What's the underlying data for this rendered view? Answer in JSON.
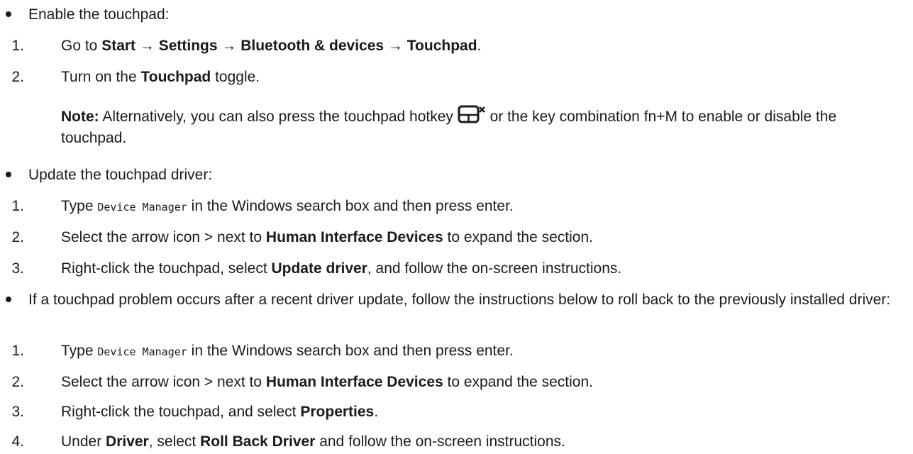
{
  "section1": {
    "bullet": "Enable the touchpad:",
    "step1": {
      "num": "1.",
      "pre": "Go to ",
      "bold": "Start → Settings → Bluetooth & devices → Touchpad",
      "post": "."
    },
    "step2": {
      "num": "2.",
      "pre": "Turn on the ",
      "bold": "Touchpad",
      "post": " toggle."
    },
    "note": {
      "label": "Note:",
      "pre": " Alternatively, you can also press the touchpad hotkey ",
      "post": " or the key combination fn+M to enable or disable the touchpad.",
      "icon": "touchpad-disable-hotkey-icon"
    }
  },
  "section2": {
    "bullet": "Update the touchpad driver:",
    "step1": {
      "num": "1.",
      "pre": "Type ",
      "mono": "Device Manager",
      "post": " in the Windows search box and then press enter."
    },
    "step2": {
      "num": "2.",
      "pre": "Select the arrow icon > next to ",
      "bold": "Human Interface Devices",
      "post": " to expand the section."
    },
    "step3": {
      "num": "3.",
      "pre": "Right-click the touchpad, select ",
      "bold": "Update driver",
      "post": ", and follow the on-screen instructions."
    }
  },
  "section3": {
    "bullet": "If a touchpad problem occurs after a recent driver update, follow the instructions below to roll back to the previously installed driver:",
    "step1": {
      "num": "1.",
      "pre": "Type ",
      "mono": "Device Manager",
      "post": " in the Windows search box and then press enter."
    },
    "step2": {
      "num": "2.",
      "pre": "Select the arrow icon > next to ",
      "bold": "Human Interface Devices",
      "post": " to expand the section."
    },
    "step3": {
      "num": "3.",
      "pre": "Right-click the touchpad, and select ",
      "bold": "Properties",
      "post": "."
    },
    "step4": {
      "num": "4.",
      "pre": "Under ",
      "bold1": "Driver",
      "mid": ", select ",
      "bold2": "Roll Back Driver",
      "post": " and follow the on-screen instructions."
    }
  }
}
